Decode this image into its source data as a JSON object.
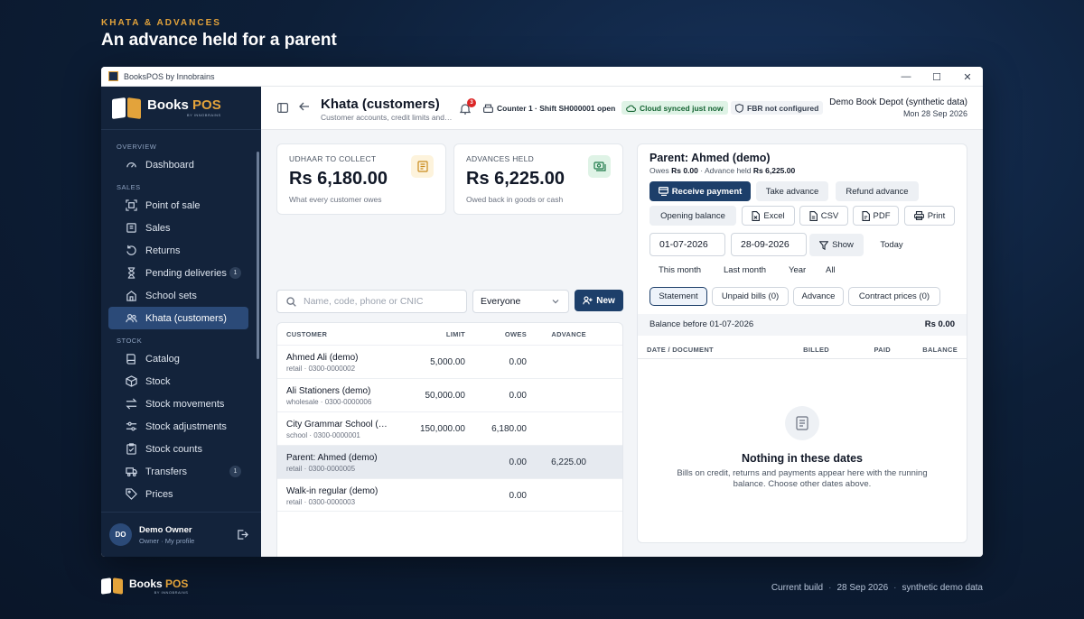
{
  "hero": {
    "kicker": "KHATA & ADVANCES",
    "title": "An advance held for a parent"
  },
  "window": {
    "title": "BooksPOS by Innobrains",
    "controls": [
      "—",
      "☐",
      "✕"
    ]
  },
  "brand": {
    "name_main": "Books",
    "name_accent": "POS",
    "tagline": "BY INNOBRAINS"
  },
  "sidebar": {
    "sections": [
      {
        "label": "OVERVIEW",
        "items": [
          {
            "label": "Dashboard",
            "icon": "gauge-icon"
          }
        ]
      },
      {
        "label": "SALES",
        "items": [
          {
            "label": "Point of sale",
            "icon": "scan-icon"
          },
          {
            "label": "Sales",
            "icon": "receipt-icon"
          },
          {
            "label": "Returns",
            "icon": "return-icon"
          },
          {
            "label": "Pending deliveries",
            "icon": "hourglass-icon",
            "badge": "1"
          },
          {
            "label": "School sets",
            "icon": "school-icon"
          },
          {
            "label": "Khata (customers)",
            "icon": "users-icon",
            "active": true
          }
        ]
      },
      {
        "label": "STOCK",
        "items": [
          {
            "label": "Catalog",
            "icon": "book-icon"
          },
          {
            "label": "Stock",
            "icon": "box-icon"
          },
          {
            "label": "Stock movements",
            "icon": "arrows-icon"
          },
          {
            "label": "Stock adjustments",
            "icon": "adjust-icon"
          },
          {
            "label": "Stock counts",
            "icon": "clipboard-icon"
          },
          {
            "label": "Transfers",
            "icon": "truck-icon",
            "badge": "1"
          },
          {
            "label": "Prices",
            "icon": "tag-icon"
          }
        ]
      }
    ],
    "profile": {
      "initials": "DO",
      "name": "Demo Owner",
      "role": "Owner",
      "link": "My profile",
      "separator": "·"
    }
  },
  "topbar": {
    "title": "Khata (customers)",
    "subtitle": "Customer accounts, credit limits and advances",
    "notification_count": "3",
    "counter": "Counter 1 · Shift SH000001 open",
    "sync": "Cloud synced just now",
    "fbr": "FBR not configured",
    "store": "Demo Book Depot (synthetic data)",
    "date": "Mon 28 Sep 2026"
  },
  "stats": {
    "udhaar": {
      "label": "UDHAAR TO COLLECT",
      "value": "Rs 6,180.00",
      "sub": "What every customer owes"
    },
    "advances": {
      "label": "ADVANCES HELD",
      "value": "Rs 6,225.00",
      "sub": "Owed back in goods or cash"
    }
  },
  "toolbar": {
    "search_placeholder": "Name, code, phone or CNIC",
    "filter": "Everyone",
    "new_label": "New"
  },
  "table": {
    "columns": [
      "CUSTOMER",
      "LIMIT",
      "OWES",
      "ADVANCE"
    ],
    "rows": [
      {
        "name": "Ahmed Ali (demo)",
        "sub": "retail · 0300-0000002",
        "limit": "5,000.00",
        "owes": "0.00",
        "advance": ""
      },
      {
        "name": "Ali Stationers (demo)",
        "sub": "wholesale · 0300-0000006",
        "limit": "50,000.00",
        "owes": "0.00",
        "advance": ""
      },
      {
        "name": "City Grammar School (demo)",
        "sub": "school · 0300-0000001",
        "limit": "150,000.00",
        "owes": "6,180.00",
        "advance": ""
      },
      {
        "name": "Parent: Ahmed (demo)",
        "sub": "retail · 0300-0000005",
        "limit": "",
        "owes": "0.00",
        "advance": "6,225.00",
        "selected": true
      },
      {
        "name": "Walk-in regular (demo)",
        "sub": "retail · 0300-0000003",
        "limit": "",
        "owes": "0.00",
        "advance": ""
      }
    ]
  },
  "detail": {
    "title": "Parent: Ahmed (demo)",
    "owes_label": "Owes",
    "owes_value": "Rs 0.00",
    "sep": "·",
    "advance_label": "Advance held",
    "advance_value": "Rs 6,225.00",
    "actions": {
      "receive": "Receive payment",
      "take_advance": "Take advance",
      "refund_advance": "Refund advance",
      "opening_balance": "Opening balance",
      "excel": "Excel",
      "csv": "CSV",
      "pdf": "PDF",
      "print": "Print"
    },
    "date_from": "01-07-2026",
    "date_to": "28-09-2026",
    "show": "Show",
    "today": "Today",
    "quick_ranges": [
      "This month",
      "Last month",
      "Year",
      "All"
    ],
    "tabs": [
      "Statement",
      "Unpaid bills (0)",
      "Advance",
      "Contract prices (0)"
    ],
    "balance_before_label": "Balance before 01-07-2026",
    "balance_before_value": "Rs 0.00",
    "ledger_columns": [
      "DATE / DOCUMENT",
      "BILLED",
      "PAID",
      "BALANCE"
    ],
    "empty_title": "Nothing in these dates",
    "empty_text": "Bills on credit, returns and payments appear here with the running balance. Choose other dates above."
  },
  "footer": {
    "build": "Current build",
    "date": "28 Sep 2026",
    "data": "synthetic demo data",
    "sep": "·"
  },
  "colors": {
    "navy": "#1d3f6a",
    "sidebar": "#13233b",
    "accent": "#e3a33b",
    "sync_green": "#166534"
  }
}
